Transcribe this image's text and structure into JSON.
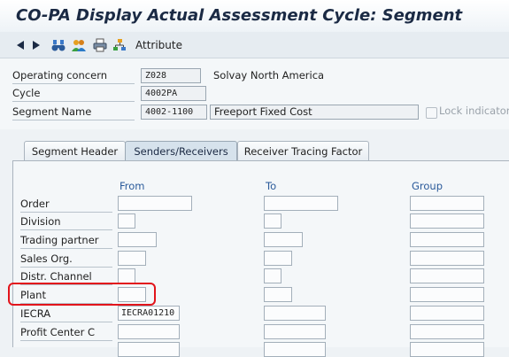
{
  "title": "CO-PA Display Actual Assessment Cycle: Segment",
  "toolbar": {
    "back_icon": "triangle-left-icon",
    "forward_icon": "triangle-right-icon",
    "find_icon": "binoculars-icon",
    "people_icon": "users-icon",
    "print_icon": "printer-icon",
    "tree_icon": "hierarchy-icon",
    "attribute_label": "Attribute"
  },
  "header": {
    "operating_concern": {
      "label": "Operating concern",
      "value": "Z028",
      "description": "Solvay North America"
    },
    "cycle": {
      "label": "Cycle",
      "value": "4002PA"
    },
    "segment_name": {
      "label": "Segment Name",
      "value": "4002-1100",
      "text": "Freeport Fixed Cost"
    },
    "lock_indicator_label": "Lock indicator"
  },
  "tabs": [
    {
      "label": "Segment Header",
      "active": false
    },
    {
      "label": "Senders/Receivers",
      "active": true
    },
    {
      "label": "Receiver Tracing Factor",
      "active": false
    }
  ],
  "columns": {
    "from": "From",
    "to": "To",
    "group": "Group"
  },
  "rows": [
    {
      "label": "Order",
      "from": ""
    },
    {
      "label": "Division",
      "from": ""
    },
    {
      "label": "Trading partner",
      "from": ""
    },
    {
      "label": "Sales Org.",
      "from": ""
    },
    {
      "label": "Distr. Channel",
      "from": ""
    },
    {
      "label": "Plant",
      "from": ""
    },
    {
      "label": "IECRA",
      "from": "IECRA01210"
    },
    {
      "label": "Profit Center C",
      "from": ""
    }
  ],
  "colors": {
    "highlight": "#e2141b",
    "column_header": "#2a5a9a",
    "title": "#1b2a44"
  }
}
